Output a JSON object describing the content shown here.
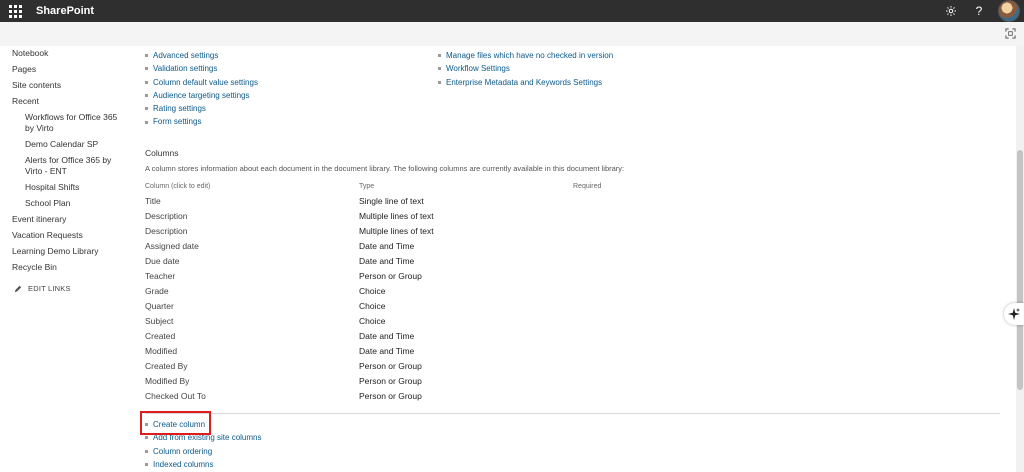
{
  "suite": {
    "brand": "SharePoint"
  },
  "leftnav": {
    "items": [
      {
        "label": "Notebook",
        "sub": false
      },
      {
        "label": "Pages",
        "sub": false
      },
      {
        "label": "Site contents",
        "sub": false
      },
      {
        "label": "Recent",
        "sub": false
      },
      {
        "label": "Workflows for Office 365 by Virto",
        "sub": true
      },
      {
        "label": "Demo Calendar SP",
        "sub": true
      },
      {
        "label": "Alerts for Office 365 by Virto - ENT",
        "sub": true
      },
      {
        "label": "Hospital Shifts",
        "sub": true
      },
      {
        "label": "School Plan",
        "sub": true
      },
      {
        "label": "Event itinerary",
        "sub": false
      },
      {
        "label": "Vacation Requests",
        "sub": false
      },
      {
        "label": "Learning Demo Library",
        "sub": false
      },
      {
        "label": "Recycle Bin",
        "sub": false
      }
    ],
    "edit_links": "EDIT LINKS"
  },
  "settings_left": [
    "Advanced settings",
    "Validation settings",
    "Column default value settings",
    "Audience targeting settings",
    "Rating settings",
    "Form settings"
  ],
  "settings_right": [
    "Manage files which have no checked in version",
    "Workflow Settings",
    "Enterprise Metadata and Keywords Settings"
  ],
  "columns_section": {
    "title": "Columns",
    "description": "A column stores information about each document in the document library. The following columns are currently available in this document library:",
    "headers": {
      "name": "Column (click to edit)",
      "type": "Type",
      "required": "Required"
    },
    "rows": [
      {
        "name": "Title",
        "type": "Single line of text"
      },
      {
        "name": "Description",
        "type": "Multiple lines of text"
      },
      {
        "name": "Description",
        "type": "Multiple lines of text"
      },
      {
        "name": "Assigned date",
        "type": "Date and Time"
      },
      {
        "name": "Due date",
        "type": "Date and Time"
      },
      {
        "name": "Teacher",
        "type": "Person or Group"
      },
      {
        "name": "Grade",
        "type": "Choice"
      },
      {
        "name": "Quarter",
        "type": "Choice"
      },
      {
        "name": "Subject",
        "type": "Choice"
      },
      {
        "name": "Created",
        "type": "Date and Time"
      },
      {
        "name": "Modified",
        "type": "Date and Time"
      },
      {
        "name": "Created By",
        "type": "Person or Group"
      },
      {
        "name": "Modified By",
        "type": "Person or Group"
      },
      {
        "name": "Checked Out To",
        "type": "Person or Group"
      }
    ]
  },
  "bottom_links": [
    "Create column",
    "Add from existing site columns",
    "Column ordering",
    "Indexed columns"
  ],
  "colors": {
    "link": "#0b5a8a",
    "suitebar": "#2f2f2f",
    "highlight": "#e01b1b"
  }
}
